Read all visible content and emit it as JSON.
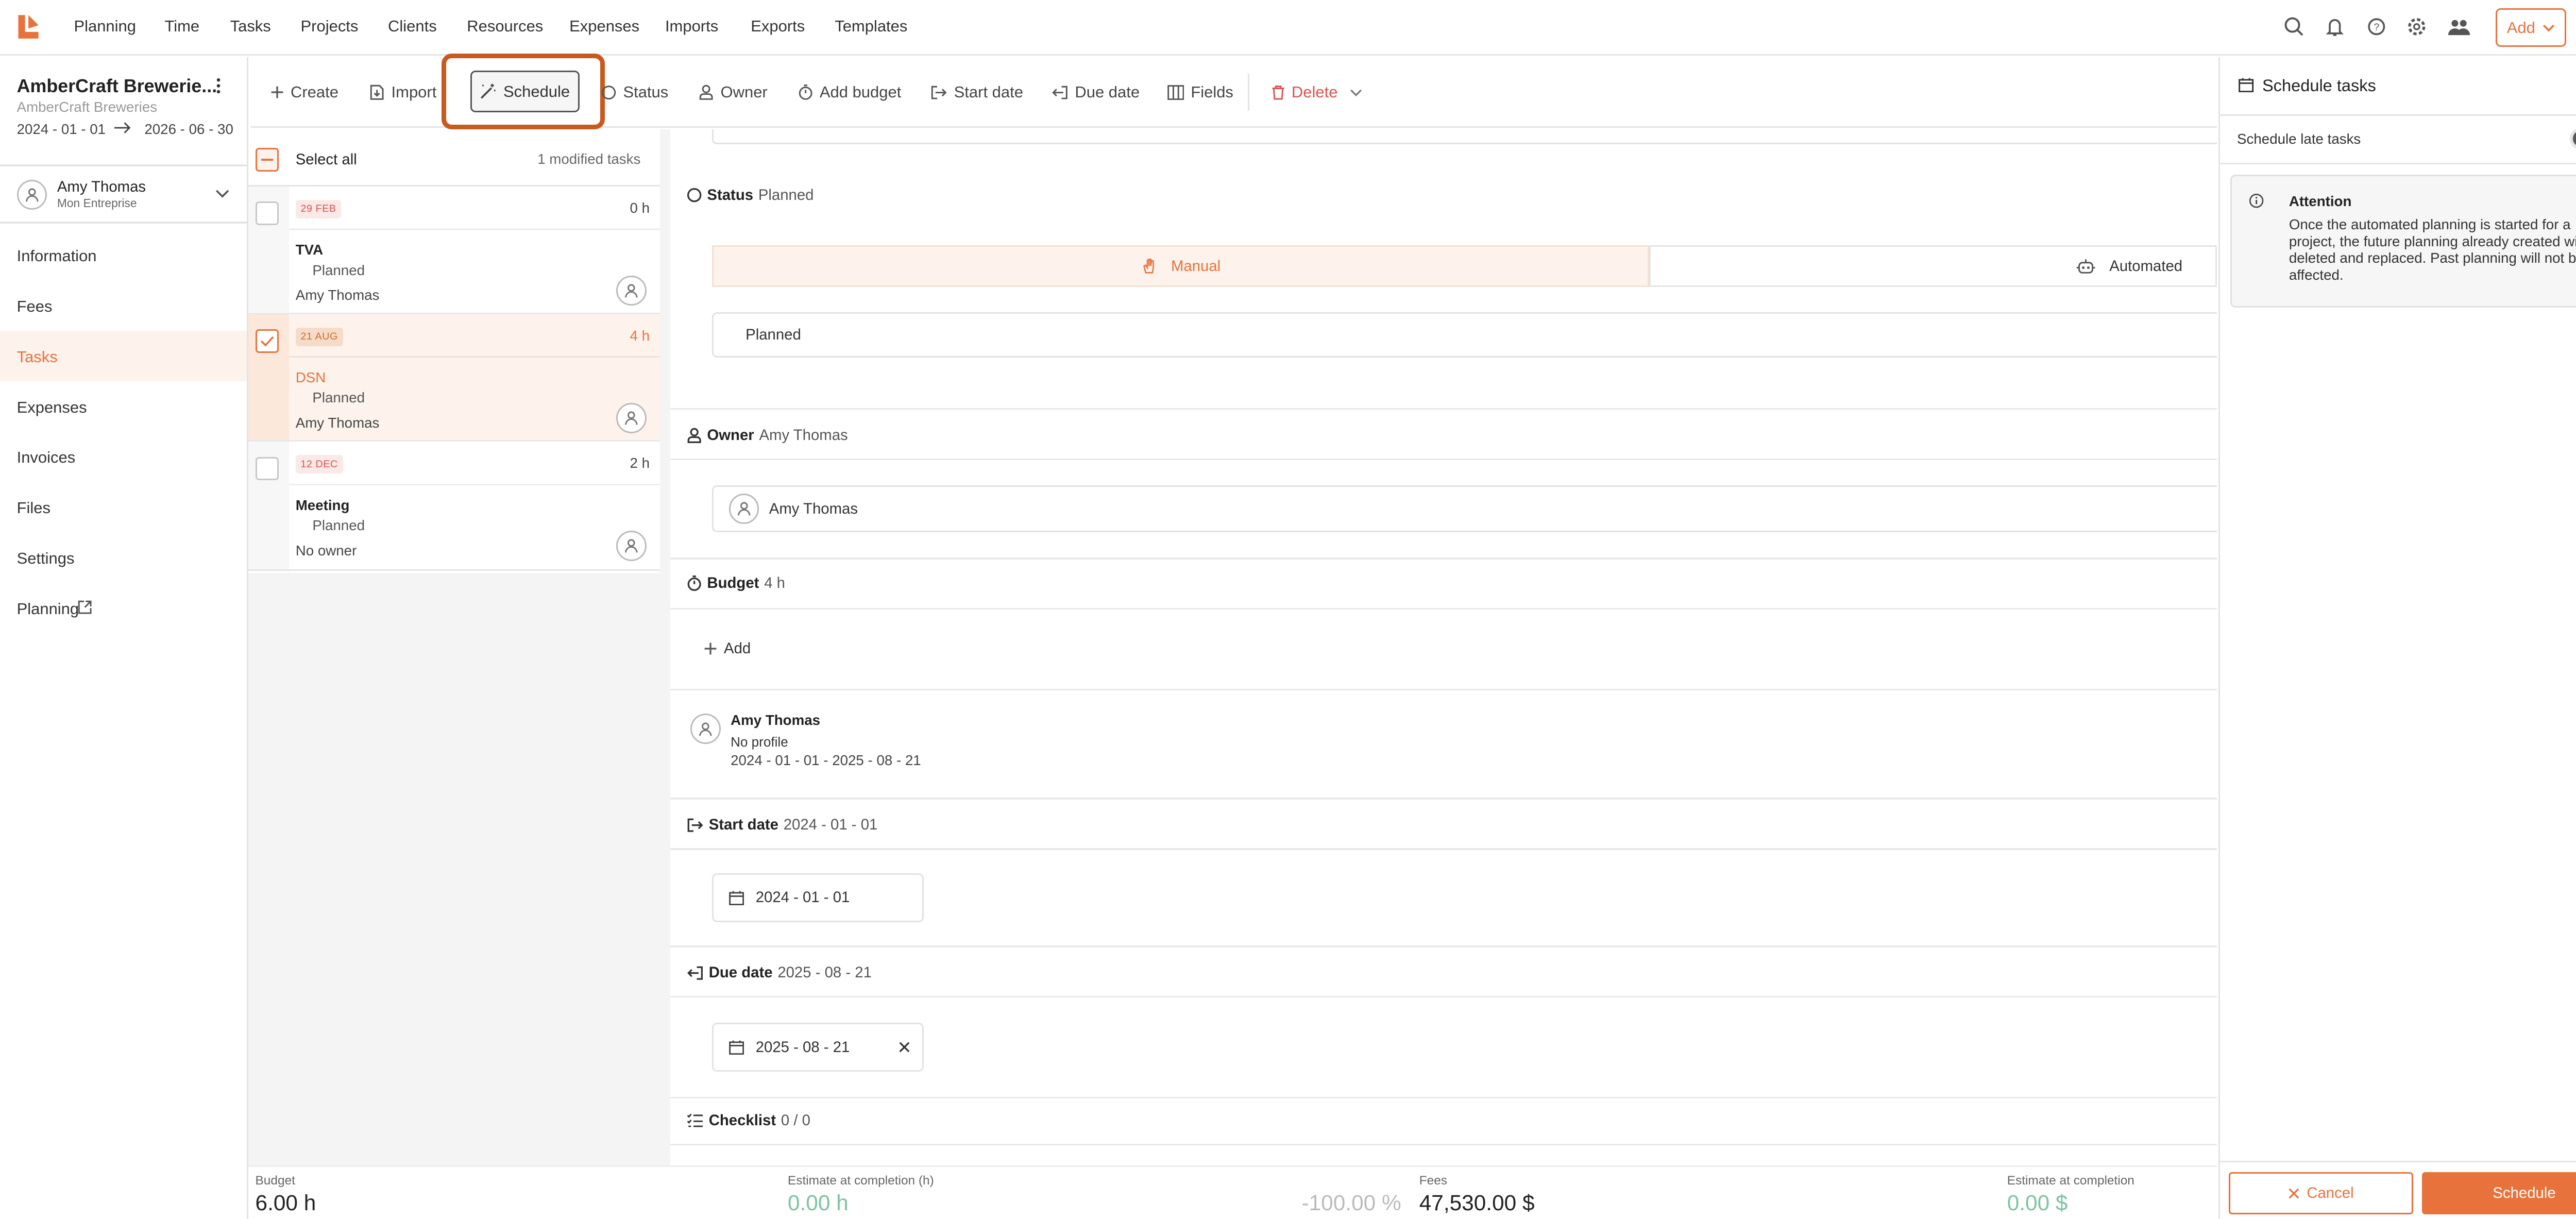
{
  "topnav": {
    "logo_name": "app-logo",
    "items": [
      "Planning",
      "Time",
      "Tasks",
      "Projects",
      "Clients",
      "Resources",
      "Expenses",
      "Imports",
      "Exports",
      "Templates"
    ],
    "add_label": "Add"
  },
  "sidebar": {
    "project_name": "AmberCraft Brewerie...",
    "client_name": "AmberCraft Breweries",
    "start_date": "2024 - 01 - 01",
    "end_date": "2026 - 06 - 30",
    "user_name": "Amy Thomas",
    "user_company": "Mon Entreprise",
    "items": [
      "Information",
      "Fees",
      "Tasks",
      "Expenses",
      "Invoices",
      "Files",
      "Settings",
      "Planning"
    ],
    "active_item": "Tasks"
  },
  "toolbar": {
    "create": "Create",
    "import": "Import",
    "schedule": "Schedule",
    "status": "Status",
    "owner": "Owner",
    "add_budget": "Add budget",
    "start_date": "Start date",
    "due_date": "Due date",
    "fields": "Fields",
    "delete": "Delete"
  },
  "tasklist": {
    "select_all": "Select all",
    "modified": "1 modified tasks",
    "tasks": [
      {
        "date": "29 FEB",
        "hours": "0 h",
        "name": "TVA",
        "status": "Planned",
        "owner": "Amy Thomas",
        "selected": false
      },
      {
        "date": "21 AUG",
        "hours": "4 h",
        "name": "DSN",
        "status": "Planned",
        "owner": "Amy Thomas",
        "selected": true
      },
      {
        "date": "12 DEC",
        "hours": "2 h",
        "name": "Meeting",
        "status": "Planned",
        "owner": "No owner",
        "selected": false
      }
    ]
  },
  "detail": {
    "status_label": "Status",
    "status_value": "Planned",
    "mode_manual": "Manual",
    "mode_automated": "Automated",
    "status_field": "Planned",
    "owner_label": "Owner",
    "owner_value": "Amy Thomas",
    "owner_field": "Amy Thomas",
    "budget_label": "Budget",
    "budget_value": "4 h",
    "add_label": "Add",
    "assignee_name": "Amy Thomas",
    "assignee_profile": "No profile",
    "assignee_range": "2024 - 01 - 01 - 2025 - 08 - 21",
    "start_label": "Start date",
    "start_value": "2024 - 01 - 01",
    "start_field": "2024 - 01 - 01",
    "due_label": "Due date",
    "due_value": "2025 - 08 - 21",
    "due_field": "2025 - 08 - 21",
    "checklist_label": "Checklist",
    "checklist_value": "0 / 0"
  },
  "footer": {
    "budget_label": "Budget",
    "budget_value": "6.00 h",
    "eac_h_label": "Estimate at completion (h)",
    "eac_h_value": "0.00 h",
    "pct_value": "-100.00 %",
    "fees_label": "Fees",
    "fees_value": "47,530.00 $",
    "eac_label": "Estimate at completion",
    "eac_value": "0.00 $"
  },
  "panel": {
    "title": "Schedule tasks",
    "late_label": "Schedule late tasks",
    "late_enabled": false,
    "attention_title": "Attention",
    "attention_text": "Once the automated planning is started for a project, the future planning already created will be deleted and replaced. Past planning will not be affected.",
    "cancel_label": "Cancel",
    "schedule_label": "Schedule"
  },
  "colors": {
    "accent": "#e8723c",
    "highlight": "#c85a1e",
    "active_bg": "#fdf3ec",
    "positive": "#7cc4a0"
  }
}
